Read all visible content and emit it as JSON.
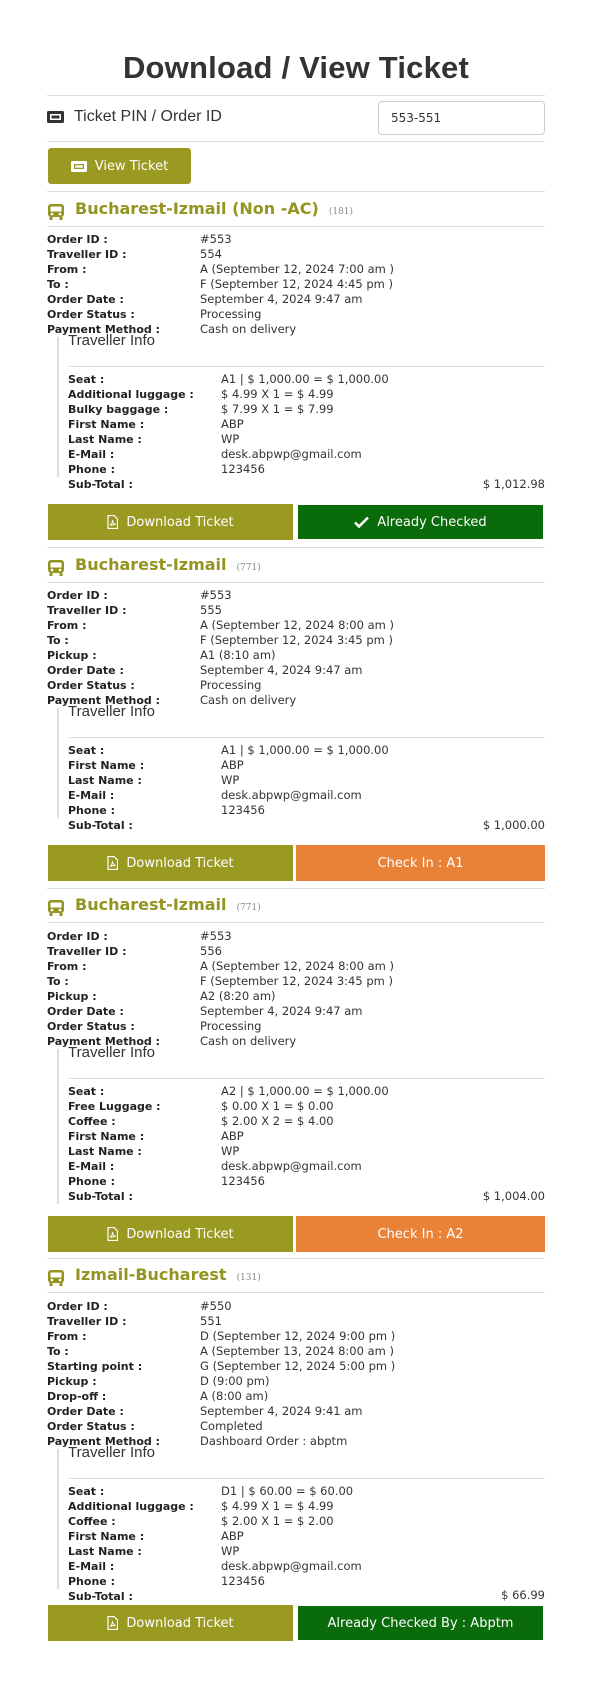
{
  "page": {
    "title": "Download / View Ticket"
  },
  "search": {
    "label": "Ticket PIN / Order ID",
    "value": "553-551",
    "button_label": "View Ticket"
  },
  "colors": {
    "olive": "#9a9a22",
    "green": "#0a6b0a",
    "orange": "#e98236"
  },
  "labels": {
    "traveller_info": "Traveller Info",
    "download": "Download Ticket"
  },
  "tickets": [
    {
      "route": "Bucharest-Izmail (Non -AC)",
      "count": "(181)",
      "details": [
        {
          "k": "Order ID :",
          "v": "#553"
        },
        {
          "k": "Traveller ID :",
          "v": "554"
        },
        {
          "k": "From :",
          "v": "A (September 12, 2024 7:00 am )"
        },
        {
          "k": "To :",
          "v": "F (September 12, 2024 4:45 pm )"
        },
        {
          "k": "Order Date :",
          "v": "September 4, 2024 9:47 am"
        },
        {
          "k": "Order Status :",
          "v": "Processing"
        },
        {
          "k": "Payment Method :",
          "v": "Cash on delivery"
        }
      ],
      "traveller": [
        {
          "k": "Seat :",
          "v": "A1  | $ 1,000.00 = $ 1,000.00"
        },
        {
          "k": "Additional luggage :",
          "v": "$ 4.99 X 1 = $ 4.99"
        },
        {
          "k": "Bulky baggage :",
          "v": "$ 7.99 X 1 = $ 7.99"
        },
        {
          "k": "First Name :",
          "v": "ABP"
        },
        {
          "k": "Last Name :",
          "v": "WP"
        },
        {
          "k": "E-Mail :",
          "v": "desk.abpwp@gmail.com"
        },
        {
          "k": "Phone :",
          "v": "123456"
        },
        {
          "k": "Sub-Total :",
          "v": ""
        }
      ],
      "subtotal": "$ 1,012.98",
      "action_label": "Already Checked"
    },
    {
      "route": "Bucharest-Izmail",
      "count": "(771)",
      "details": [
        {
          "k": "Order ID :",
          "v": "#553"
        },
        {
          "k": "Traveller ID :",
          "v": "555"
        },
        {
          "k": "From :",
          "v": "A (September 12, 2024 8:00 am )"
        },
        {
          "k": "To :",
          "v": "F (September 12, 2024 3:45 pm )"
        },
        {
          "k": "Pickup :",
          "v": "A1 (8:10 am)"
        },
        {
          "k": "Order Date :",
          "v": "September 4, 2024 9:47 am"
        },
        {
          "k": "Order Status :",
          "v": "Processing"
        },
        {
          "k": "Payment Method :",
          "v": "Cash on delivery"
        }
      ],
      "traveller": [
        {
          "k": "Seat :",
          "v": "A1  | $ 1,000.00 = $ 1,000.00"
        },
        {
          "k": "First Name :",
          "v": "ABP"
        },
        {
          "k": "Last Name :",
          "v": "WP"
        },
        {
          "k": "E-Mail :",
          "v": "desk.abpwp@gmail.com"
        },
        {
          "k": "Phone :",
          "v": "123456"
        },
        {
          "k": "Sub-Total :",
          "v": ""
        }
      ],
      "subtotal": "$ 1,000.00",
      "action_label": "Check In : A1"
    },
    {
      "route": "Bucharest-Izmail",
      "count": "(771)",
      "details": [
        {
          "k": "Order ID :",
          "v": "#553"
        },
        {
          "k": "Traveller ID :",
          "v": "556"
        },
        {
          "k": "From :",
          "v": "A (September 12, 2024 8:00 am )"
        },
        {
          "k": "To :",
          "v": "F (September 12, 2024 3:45 pm )"
        },
        {
          "k": "Pickup :",
          "v": "A2 (8:20 am)"
        },
        {
          "k": "Order Date :",
          "v": "September 4, 2024 9:47 am"
        },
        {
          "k": "Order Status :",
          "v": "Processing"
        },
        {
          "k": "Payment Method :",
          "v": "Cash on delivery"
        }
      ],
      "traveller": [
        {
          "k": "Seat :",
          "v": "A2  | $ 1,000.00 = $ 1,000.00"
        },
        {
          "k": "Free Luggage :",
          "v": "$ 0.00 X 1 = $ 0.00"
        },
        {
          "k": "Coffee :",
          "v": "$ 2.00 X 2 = $ 4.00"
        },
        {
          "k": "First Name :",
          "v": "ABP"
        },
        {
          "k": "Last Name :",
          "v": "WP"
        },
        {
          "k": "E-Mail :",
          "v": "desk.abpwp@gmail.com"
        },
        {
          "k": "Phone :",
          "v": "123456"
        },
        {
          "k": "Sub-Total :",
          "v": ""
        }
      ],
      "subtotal": "$ 1,004.00",
      "action_label": "Check In : A2"
    },
    {
      "route": "Izmail-Bucharest",
      "count": "(131)",
      "details": [
        {
          "k": "Order ID :",
          "v": "#550"
        },
        {
          "k": "Traveller ID :",
          "v": "551"
        },
        {
          "k": "From :",
          "v": "D (September 12, 2024 9:00 pm )"
        },
        {
          "k": "To :",
          "v": "A (September 13, 2024 8:00 am )"
        },
        {
          "k": "Starting point :",
          "v": "G (September 12, 2024 5:00 pm )"
        },
        {
          "k": "Pickup :",
          "v": "D (9:00 pm)"
        },
        {
          "k": "Drop-off :",
          "v": "A (8:00 am)"
        },
        {
          "k": "Order Date :",
          "v": "September 4, 2024 9:41 am"
        },
        {
          "k": "Order Status :",
          "v": "Completed"
        },
        {
          "k": "Payment Method :",
          "v": "Dashboard Order : abptm"
        }
      ],
      "traveller": [
        {
          "k": "Seat :",
          "v": "D1  | $ 60.00 = $ 60.00"
        },
        {
          "k": "Additional luggage :",
          "v": "$ 4.99 X 1 = $ 4.99"
        },
        {
          "k": "Coffee :",
          "v": "$ 2.00 X 1 = $ 2.00"
        },
        {
          "k": "First Name :",
          "v": "ABP"
        },
        {
          "k": "Last Name :",
          "v": "WP"
        },
        {
          "k": "E-Mail :",
          "v": "desk.abpwp@gmail.com"
        },
        {
          "k": "Phone :",
          "v": "123456"
        },
        {
          "k": "Sub-Total :",
          "v": ""
        }
      ],
      "subtotal": "$ 66.99",
      "action_label": "Already Checked By : Abptm"
    }
  ]
}
